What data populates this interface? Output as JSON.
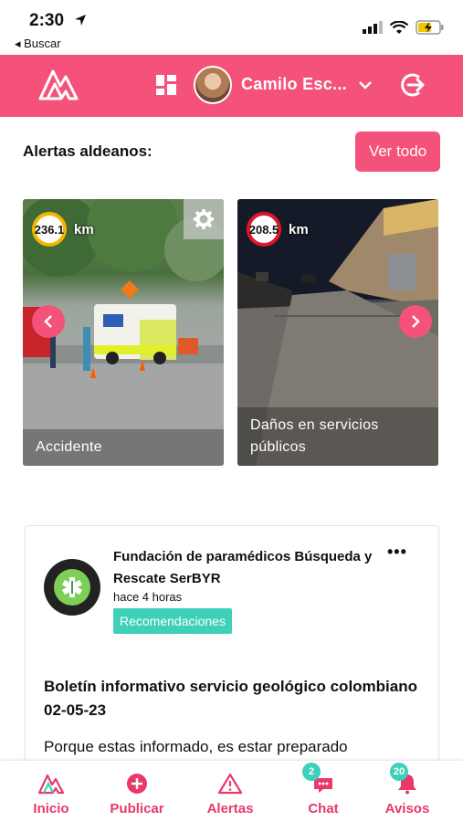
{
  "status_bar": {
    "time": "2:30",
    "back_label": "◂ Buscar"
  },
  "header": {
    "user_name": "Camilo Esc..."
  },
  "alerts": {
    "title": "Alertas aldeanos:",
    "see_all": "Ver todo",
    "cards": [
      {
        "distance": "236.1",
        "unit": "km",
        "caption": "Accidente"
      },
      {
        "distance": "208.5",
        "unit": "km",
        "caption": "Daños en servicios públicos"
      }
    ]
  },
  "post": {
    "org_name": "Fundación de paramédicos Búsqueda y Rescate SerBYR",
    "time": "hace 4 horas",
    "tag": "Recomendaciones",
    "more": "•••",
    "title": "Boletín informativo servicio geológico colombiano 02-05-23",
    "body": "Porque estas informado, es estar preparado"
  },
  "bottom_nav": {
    "items": [
      {
        "label": "Inicio"
      },
      {
        "label": "Publicar"
      },
      {
        "label": "Alertas"
      },
      {
        "label": "Chat",
        "badge": "2"
      },
      {
        "label": "Avisos",
        "badge": "20"
      }
    ]
  },
  "colors": {
    "brand": "#f4527a",
    "accent": "#3ed0b8"
  }
}
